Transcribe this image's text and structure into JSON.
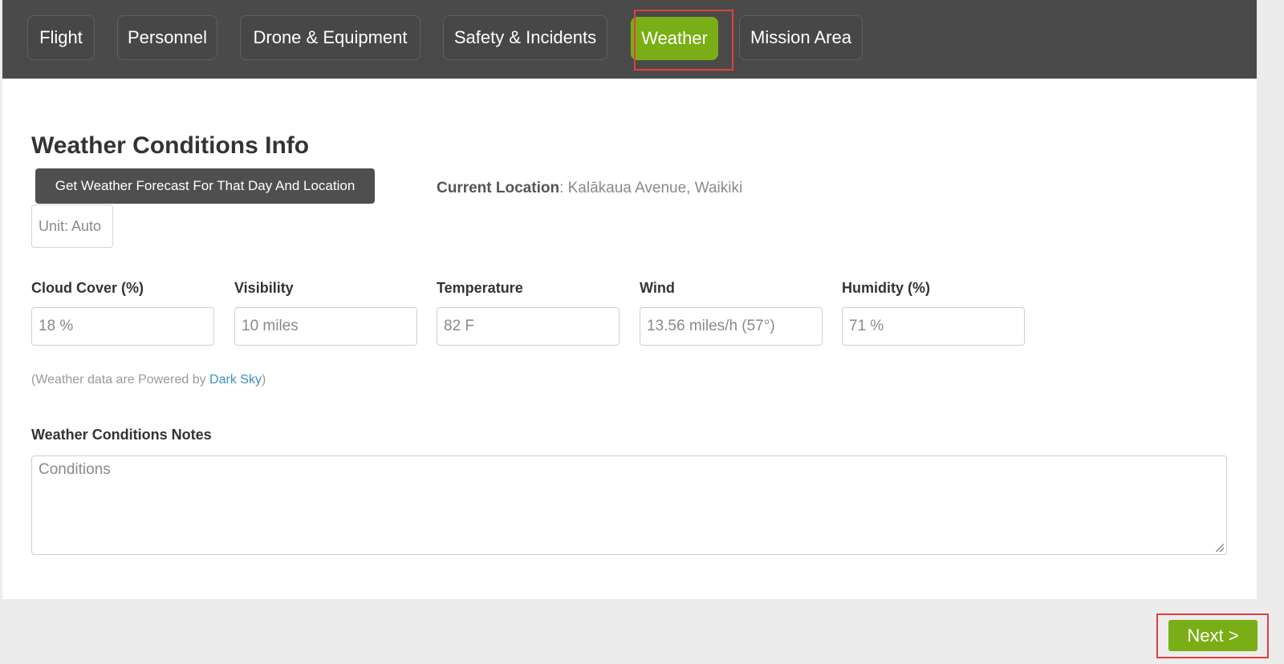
{
  "tabs": [
    {
      "label": "Flight"
    },
    {
      "label": "Personnel"
    },
    {
      "label": "Drone & Equipment"
    },
    {
      "label": "Safety & Incidents"
    },
    {
      "label": "Weather",
      "active": true
    },
    {
      "label": "Mission Area"
    }
  ],
  "section": {
    "title": "Weather Conditions Info",
    "forecast_button": "Get Weather Forecast For That Day And Location",
    "unit": "Unit: Auto",
    "location_label": "Current Location",
    "location_sep": ": ",
    "location_value": "Kalākaua Avenue, Waikiki"
  },
  "fields": [
    {
      "label": "Cloud Cover (%)",
      "value": "18 %"
    },
    {
      "label": "Visibility",
      "value": "10 miles"
    },
    {
      "label": "Temperature",
      "value": "82 F"
    },
    {
      "label": "Wind",
      "value": "13.56 miles/h (57°)"
    },
    {
      "label": "Humidity (%)",
      "value": "71 %"
    }
  ],
  "powered": {
    "prefix": "(Weather data are Powered by ",
    "link": "Dark Sky",
    "suffix": ")"
  },
  "notes": {
    "label": "Weather Conditions Notes",
    "placeholder": "Conditions"
  },
  "next_button": "Next >",
  "colors": {
    "accent": "#7aae16",
    "topbar": "#4a4a4a",
    "highlight": "#e04040",
    "link": "#3a90bf"
  }
}
